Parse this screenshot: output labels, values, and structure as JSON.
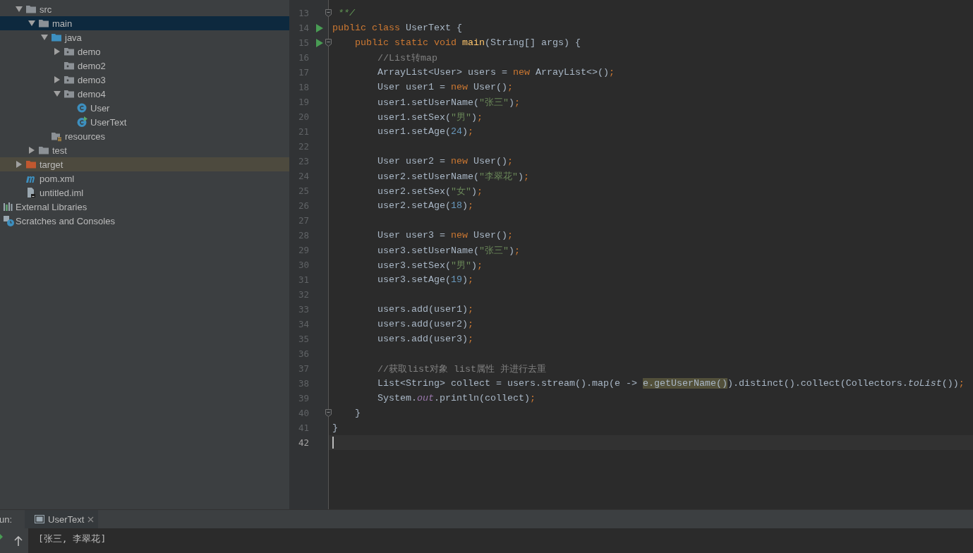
{
  "project_tree": [
    {
      "label": "src",
      "kind": "folder",
      "expanded": true,
      "selected": false,
      "children": [
        {
          "label": "main",
          "kind": "folder",
          "expanded": true,
          "selected": true,
          "children": [
            {
              "label": "java",
              "kind": "source",
              "expanded": true,
              "selected": false,
              "children": [
                {
                  "label": "demo",
                  "kind": "package",
                  "expanded": false,
                  "selected": false
                },
                {
                  "label": "demo2",
                  "kind": "package",
                  "selected": false
                },
                {
                  "label": "demo3",
                  "kind": "package",
                  "expanded": false,
                  "selected": false
                },
                {
                  "label": "demo4",
                  "kind": "package",
                  "expanded": true,
                  "selected": false,
                  "children": [
                    {
                      "label": "User",
                      "kind": "class",
                      "selected": false
                    },
                    {
                      "label": "UserText",
                      "kind": "runnable",
                      "selected": false
                    }
                  ]
                }
              ]
            },
            {
              "label": "resources",
              "kind": "resources",
              "selected": false
            }
          ]
        },
        {
          "label": "test",
          "kind": "folder",
          "expanded": false,
          "selected": false
        }
      ]
    },
    {
      "label": "target",
      "kind": "excluded",
      "expanded": false,
      "selected": false
    },
    {
      "label": "pom.xml",
      "kind": "maven",
      "selected": false
    },
    {
      "label": "untitled.iml",
      "kind": "module",
      "selected": false
    }
  ],
  "root_items": [
    {
      "label": "External Libraries",
      "kind": "libraries",
      "selected": false
    },
    {
      "label": "Scratches and Consoles",
      "kind": "scratches",
      "selected": false
    }
  ],
  "editor": {
    "lines": [
      {
        "number": "13",
        "current": false,
        "markers": [
          {
            "kind": "fold"
          }
        ],
        "tokens": [
          {
            "kind": "doc",
            "text": " **/"
          }
        ]
      },
      {
        "number": "14",
        "current": false,
        "markers": [
          {
            "kind": "run"
          }
        ],
        "tokens": [
          {
            "kind": "keyword",
            "text": "public class "
          },
          {
            "kind": "plain",
            "text": "UserText {"
          }
        ]
      },
      {
        "number": "15",
        "current": false,
        "markers": [
          {
            "kind": "run"
          },
          {
            "kind": "fold"
          }
        ],
        "tokens": [
          {
            "kind": "keyword",
            "text": "    public static void "
          },
          {
            "kind": "method",
            "text": "main"
          },
          {
            "kind": "plain",
            "text": "(String[] args) {"
          }
        ]
      },
      {
        "number": "16",
        "current": false,
        "tokens": [
          {
            "kind": "comment",
            "text": "        //List转map"
          }
        ]
      },
      {
        "number": "17",
        "current": false,
        "tokens": [
          {
            "kind": "plain",
            "text": "        ArrayList<User> users = "
          },
          {
            "kind": "keyword",
            "text": "new"
          },
          {
            "kind": "plain",
            "text": " ArrayList<>()"
          },
          {
            "kind": "keyword",
            "text": ";"
          }
        ]
      },
      {
        "number": "18",
        "current": false,
        "tokens": [
          {
            "kind": "plain",
            "text": "        User user1 = "
          },
          {
            "kind": "keyword",
            "text": "new"
          },
          {
            "kind": "plain",
            "text": " User()"
          },
          {
            "kind": "keyword",
            "text": ";"
          }
        ]
      },
      {
        "number": "19",
        "current": false,
        "tokens": [
          {
            "kind": "plain",
            "text": "        user1.setUserName("
          },
          {
            "kind": "string",
            "text": "\"张三\""
          },
          {
            "kind": "plain",
            "text": ")"
          },
          {
            "kind": "keyword",
            "text": ";"
          }
        ]
      },
      {
        "number": "20",
        "current": false,
        "tokens": [
          {
            "kind": "plain",
            "text": "        user1.setSex("
          },
          {
            "kind": "string",
            "text": "\"男\""
          },
          {
            "kind": "plain",
            "text": ")"
          },
          {
            "kind": "keyword",
            "text": ";"
          }
        ]
      },
      {
        "number": "21",
        "current": false,
        "tokens": [
          {
            "kind": "plain",
            "text": "        user1.setAge("
          },
          {
            "kind": "number",
            "text": "24"
          },
          {
            "kind": "plain",
            "text": ")"
          },
          {
            "kind": "keyword",
            "text": ";"
          }
        ]
      },
      {
        "number": "22",
        "current": false
      },
      {
        "number": "23",
        "current": false,
        "tokens": [
          {
            "kind": "plain",
            "text": "        User user2 = "
          },
          {
            "kind": "keyword",
            "text": "new"
          },
          {
            "kind": "plain",
            "text": " User()"
          },
          {
            "kind": "keyword",
            "text": ";"
          }
        ]
      },
      {
        "number": "24",
        "current": false,
        "tokens": [
          {
            "kind": "plain",
            "text": "        user2.setUserName("
          },
          {
            "kind": "string",
            "text": "\"李翠花\""
          },
          {
            "kind": "plain",
            "text": ")"
          },
          {
            "kind": "keyword",
            "text": ";"
          }
        ]
      },
      {
        "number": "25",
        "current": false,
        "tokens": [
          {
            "kind": "plain",
            "text": "        user2.setSex("
          },
          {
            "kind": "string",
            "text": "\"女\""
          },
          {
            "kind": "plain",
            "text": ")"
          },
          {
            "kind": "keyword",
            "text": ";"
          }
        ]
      },
      {
        "number": "26",
        "current": false,
        "tokens": [
          {
            "kind": "plain",
            "text": "        user2.setAge("
          },
          {
            "kind": "number",
            "text": "18"
          },
          {
            "kind": "plain",
            "text": ")"
          },
          {
            "kind": "keyword",
            "text": ";"
          }
        ]
      },
      {
        "number": "27",
        "current": false
      },
      {
        "number": "28",
        "current": false,
        "tokens": [
          {
            "kind": "plain",
            "text": "        User user3 = "
          },
          {
            "kind": "keyword",
            "text": "new"
          },
          {
            "kind": "plain",
            "text": " User()"
          },
          {
            "kind": "keyword",
            "text": ";"
          }
        ]
      },
      {
        "number": "29",
        "current": false,
        "tokens": [
          {
            "kind": "plain",
            "text": "        user3.setUserName("
          },
          {
            "kind": "string",
            "text": "\"张三\""
          },
          {
            "kind": "plain",
            "text": ")"
          },
          {
            "kind": "keyword",
            "text": ";"
          }
        ]
      },
      {
        "number": "30",
        "current": false,
        "tokens": [
          {
            "kind": "plain",
            "text": "        user3.setSex("
          },
          {
            "kind": "string",
            "text": "\"男\""
          },
          {
            "kind": "plain",
            "text": ")"
          },
          {
            "kind": "keyword",
            "text": ";"
          }
        ]
      },
      {
        "number": "31",
        "current": false,
        "tokens": [
          {
            "kind": "plain",
            "text": "        user3.setAge("
          },
          {
            "kind": "number",
            "text": "19"
          },
          {
            "kind": "plain",
            "text": ")"
          },
          {
            "kind": "keyword",
            "text": ";"
          }
        ]
      },
      {
        "number": "32",
        "current": false
      },
      {
        "number": "33",
        "current": false,
        "tokens": [
          {
            "kind": "plain",
            "text": "        users.add(user1)"
          },
          {
            "kind": "keyword",
            "text": ";"
          }
        ]
      },
      {
        "number": "34",
        "current": false,
        "tokens": [
          {
            "kind": "plain",
            "text": "        users.add(user2)"
          },
          {
            "kind": "keyword",
            "text": ";"
          }
        ]
      },
      {
        "number": "35",
        "current": false,
        "tokens": [
          {
            "kind": "plain",
            "text": "        users.add(user3)"
          },
          {
            "kind": "keyword",
            "text": ";"
          }
        ]
      },
      {
        "number": "36",
        "current": false
      },
      {
        "number": "37",
        "current": false,
        "tokens": [
          {
            "kind": "comment",
            "text": "        //获取list对象 list属性 并进行去重"
          }
        ]
      },
      {
        "number": "38",
        "current": false,
        "tokens": [
          {
            "kind": "plain",
            "text": "        List<String> collect = users.stream().map(e -> "
          },
          {
            "kind": "match",
            "text": "e.getUserName()"
          },
          {
            "kind": "plain",
            "text": ").distinct().collect(Collectors."
          },
          {
            "kind": "static",
            "text": "toList"
          },
          {
            "kind": "plain",
            "text": "())"
          },
          {
            "kind": "keyword",
            "text": ";"
          }
        ]
      },
      {
        "number": "39",
        "current": false,
        "tokens": [
          {
            "kind": "plain",
            "text": "        System."
          },
          {
            "kind": "field",
            "text": "out"
          },
          {
            "kind": "plain",
            "text": ".println(collect)"
          },
          {
            "kind": "keyword",
            "text": ";"
          }
        ]
      },
      {
        "number": "40",
        "current": false,
        "markers": [
          {
            "kind": "fold"
          }
        ],
        "tokens": [
          {
            "kind": "plain",
            "text": "    }"
          }
        ]
      },
      {
        "number": "41",
        "current": false,
        "tokens": [
          {
            "kind": "plain",
            "text": "}"
          }
        ]
      },
      {
        "number": "42",
        "current": true
      }
    ]
  },
  "run_panel": {
    "label": "un:",
    "tabs": [
      {
        "label": "UserText",
        "selected": true
      }
    ],
    "output": [
      "[张三, 李翠花]"
    ]
  }
}
